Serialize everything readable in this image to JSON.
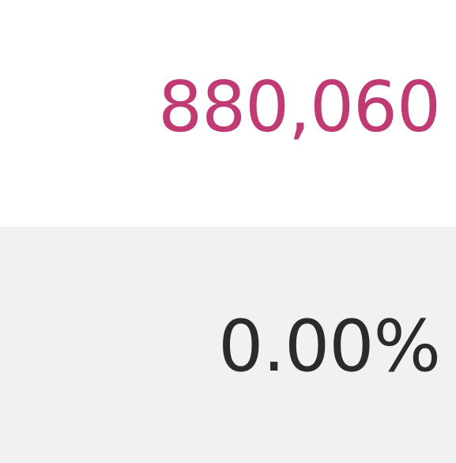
{
  "stats": {
    "count": "880,060",
    "percent": "0.00%"
  },
  "colors": {
    "count_text": "#c03b74",
    "percent_text": "#2b2b2b",
    "top_background": "#ffffff",
    "bottom_background": "#f1f1f1"
  }
}
